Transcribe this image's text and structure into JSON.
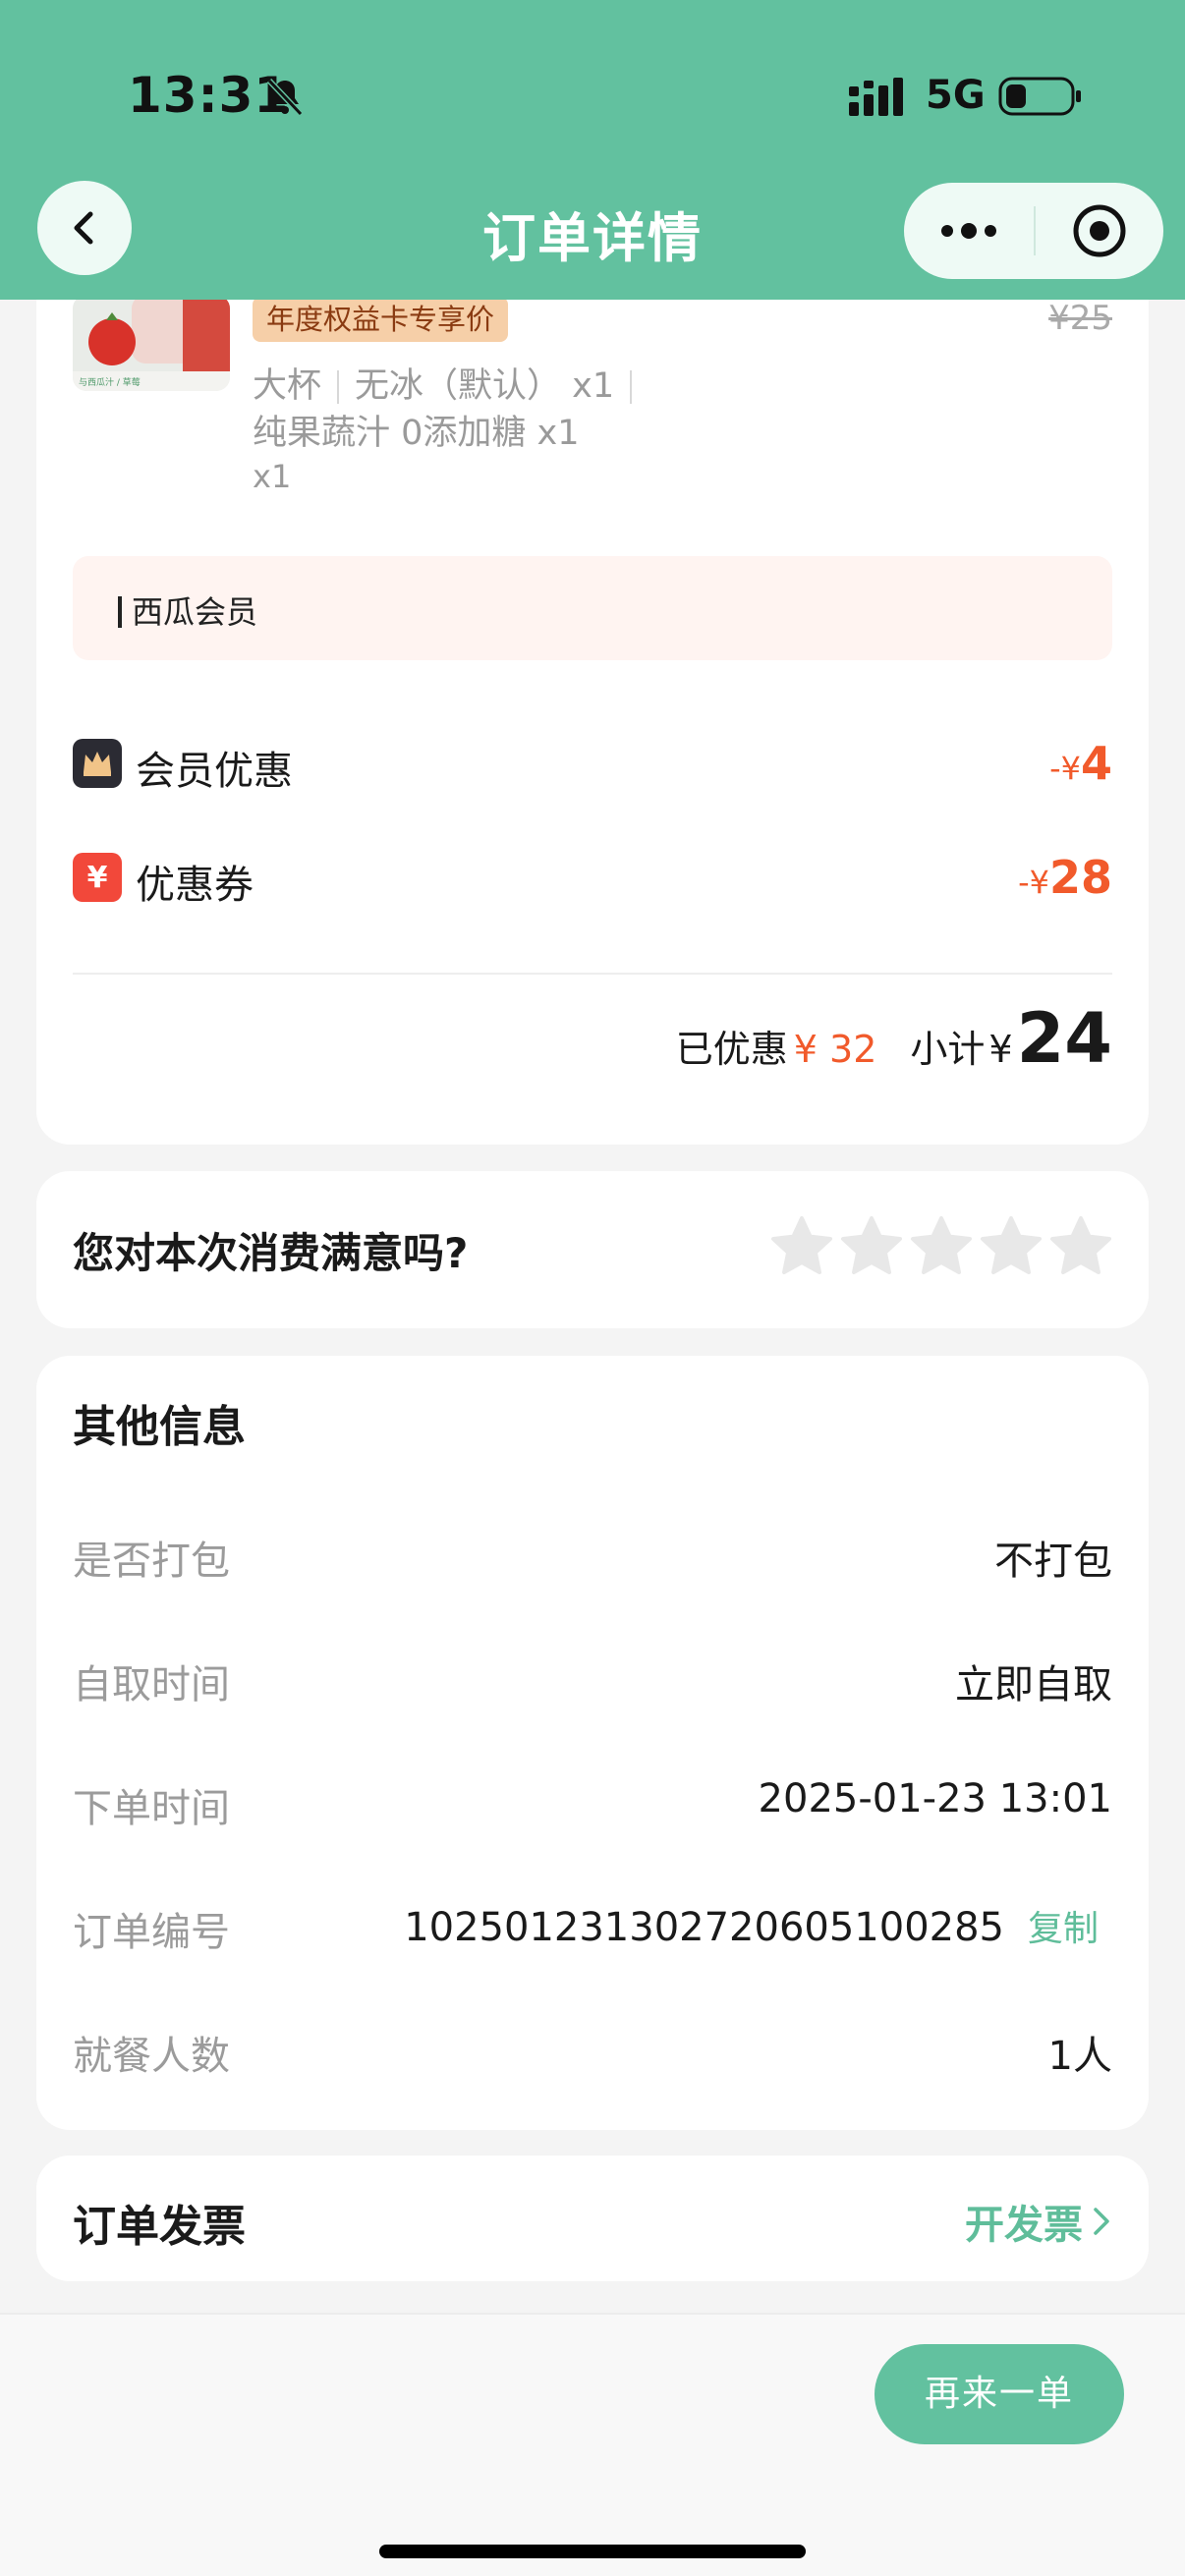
{
  "status_bar": {
    "time": "13:31",
    "network": "5G"
  },
  "nav": {
    "title": "订单详情"
  },
  "product": {
    "tag": "年度权益卡专享价",
    "original_price": "¥25",
    "spec_line1": {
      "size": "大杯",
      "ice": "无冰（默认）",
      "ice_qty": "x1"
    },
    "spec_line2": "纯果蔬汁 0添加糖 x1",
    "spec_line3": "x1",
    "thumb_caption": "与西瓜汁 / 草莓"
  },
  "member_banner": {
    "text": "西瓜会员"
  },
  "discounts": [
    {
      "label": "会员优惠",
      "minus": "-",
      "yen": "¥",
      "amount": "4",
      "icon": "crown-icon"
    },
    {
      "label": "优惠券",
      "minus": "-",
      "yen": "¥",
      "amount": "28",
      "icon": "coupon-icon",
      "icon_text": "¥"
    }
  ],
  "subtotal": {
    "saved_label": "已优惠",
    "saved_amount": "¥ 32",
    "label": "小计",
    "yen": "¥",
    "value": "24"
  },
  "rating": {
    "question": "您对本次消费满意吗?",
    "max_stars": 5,
    "selected": 0
  },
  "other_info": {
    "title": "其他信息",
    "rows": [
      {
        "label": "是否打包",
        "value": "不打包"
      },
      {
        "label": "自取时间",
        "value": "立即自取"
      },
      {
        "label": "下单时间",
        "value": "2025-01-23 13:01"
      },
      {
        "label": "订单编号",
        "value": "10250123130272060510028​5",
        "action": "复制"
      },
      {
        "label": "就餐人数",
        "value": "1人"
      }
    ]
  },
  "invoice": {
    "title": "订单发票",
    "action": "开发票"
  },
  "bottom": {
    "reorder_label": "再来一单"
  },
  "colors": {
    "brand": "#62c19f",
    "accent_green": "#5fbd9a",
    "discount_red": "#f15a2b",
    "tag_bg": "#f6cfa8"
  }
}
